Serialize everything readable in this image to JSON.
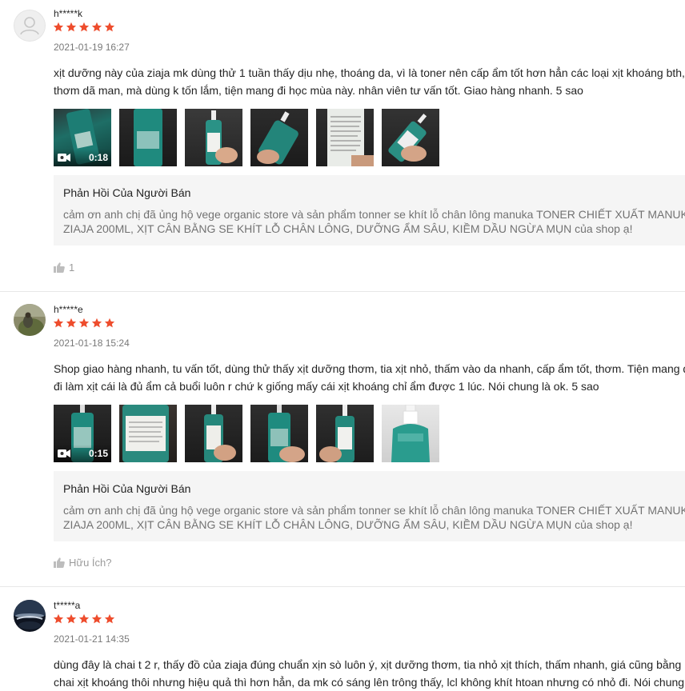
{
  "colors": {
    "star": "#ee4d2d",
    "reply_bg": "#f5f5f5",
    "muted": "#757575"
  },
  "reviews": [
    {
      "username": "h*****k",
      "date": "2021-01-19 16:27",
      "rating": 5,
      "content_lines": [
        "xịt dưỡng này của ziaja mk dùng thử 1 tuần thấy dịu nhẹ, thoáng da, vì là toner nên cấp ẩm tốt hơn hẳn các loại xịt khoáng bth,",
        "thơm dã man, mà dùng k tốn lắm, tiện mang đi học mùa này. nhân viên tư vấn tốt. Giao hàng nhanh. 5 sao"
      ],
      "video_duration": "0:18",
      "reply_title": "Phản Hồi Của Người Bán",
      "reply_lines": [
        "cảm ơn anh chị đã ủng hộ vege organic store và sản phẩm tonner se khít lỗ chân lông manuka TONER CHIẾT XUẤT MANUKA",
        "ZIAJA 200ML, XỊT CÂN BẰNG SE KHÍT LỖ CHÂN LÔNG, DƯỠNG ẨM SÂU, KIỀM DẦU NGỪA MỤN  của shop ạ!"
      ],
      "like_label": "1"
    },
    {
      "username": "h*****e",
      "date": "2021-01-18 15:24",
      "rating": 5,
      "content_lines": [
        "Shop giao hàng nhanh, tu vấn tốt, dùng thử thấy xịt dưỡng thơm, tia xịt nhỏ, thấm vào da nhanh, cấp ẩm tốt, thơm. Tiện mang đi",
        "đi làm xịt cái là đủ ẩm cả buổi luôn r chứ k giống mấy cái xịt khoáng chỉ ẩm được 1 lúc. Nói chung là ok. 5 sao"
      ],
      "video_duration": "0:15",
      "reply_title": "Phản Hồi Của Người Bán",
      "reply_lines": [
        "cảm ơn anh chị đã ủng hộ vege organic store và sản phẩm tonner se khít lỗ chân lông manuka TONER CHIẾT XUẤT MANUKA",
        "ZIAJA 200ML, XỊT CÂN BẰNG SE KHÍT LỖ CHÂN LÔNG, DƯỠNG ẨM SÂU, KIỀM DẦU NGỪA MỤN  của shop ạ!"
      ],
      "like_label": "Hữu Ích?"
    },
    {
      "username": "t*****a",
      "date": "2021-01-21 14:35",
      "rating": 5,
      "content_lines": [
        "dùng đây là chai t 2 r, thấy đồ của ziaja đúng chuẩn xịn sò luôn ý, xịt dưỡng thơm, tia nhỏ xịt thích, thấm nhanh, giá cũng bằng mấy",
        "chai xịt khoáng thôi nhưng hiệu quả thì hơn hẳn, da mk có sáng lên trông thấy, lcl không khít htoan nhưng có nhỏ đi. Nói chung"
      ]
    }
  ]
}
